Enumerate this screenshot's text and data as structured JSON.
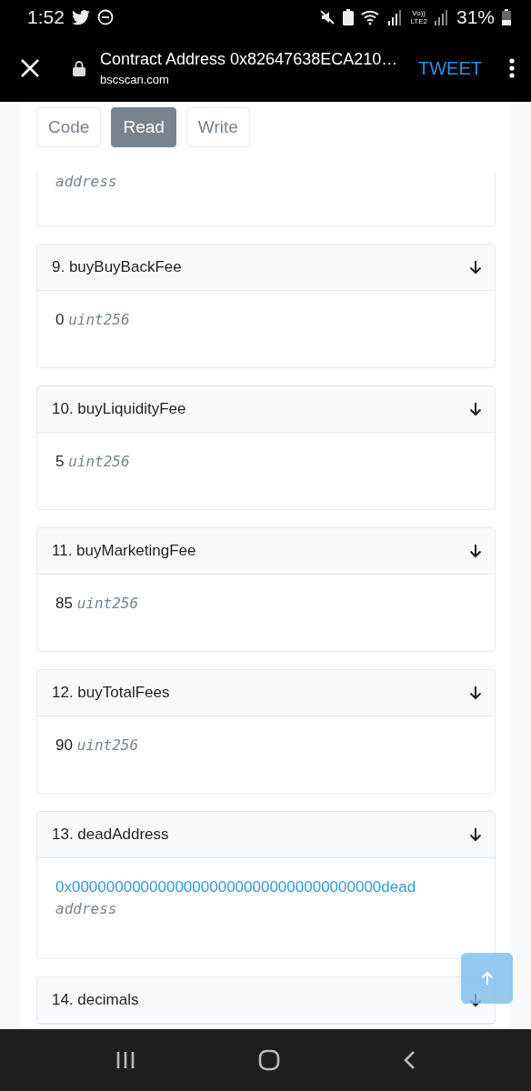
{
  "status_bar": {
    "time": "1:52",
    "volte": "Vo))",
    "lte": "LTE2",
    "battery": "31%"
  },
  "browser": {
    "title": "Contract Address 0x82647638ECA210…",
    "domain": "bscscan.com",
    "action": "TWEET"
  },
  "tabs": [
    {
      "label": "Code",
      "selected": false
    },
    {
      "label": "Read",
      "selected": true
    },
    {
      "label": "Write",
      "selected": false
    }
  ],
  "partial_result": {
    "type": "address"
  },
  "functions": [
    {
      "title": "9. buyBuyBackFee",
      "kind": "value",
      "value": "0",
      "type": "uint256"
    },
    {
      "title": "10. buyLiquidityFee",
      "kind": "value",
      "value": "5",
      "type": "uint256"
    },
    {
      "title": "11. buyMarketingFee",
      "kind": "value",
      "value": "85",
      "type": "uint256"
    },
    {
      "title": "12. buyTotalFees",
      "kind": "value",
      "value": "90",
      "type": "uint256"
    },
    {
      "title": "13. deadAddress",
      "kind": "address",
      "value": "0x000000000000000000000000000000000000dead",
      "type": "address"
    },
    {
      "title": "14. decimals",
      "kind": "collapsed"
    }
  ]
}
